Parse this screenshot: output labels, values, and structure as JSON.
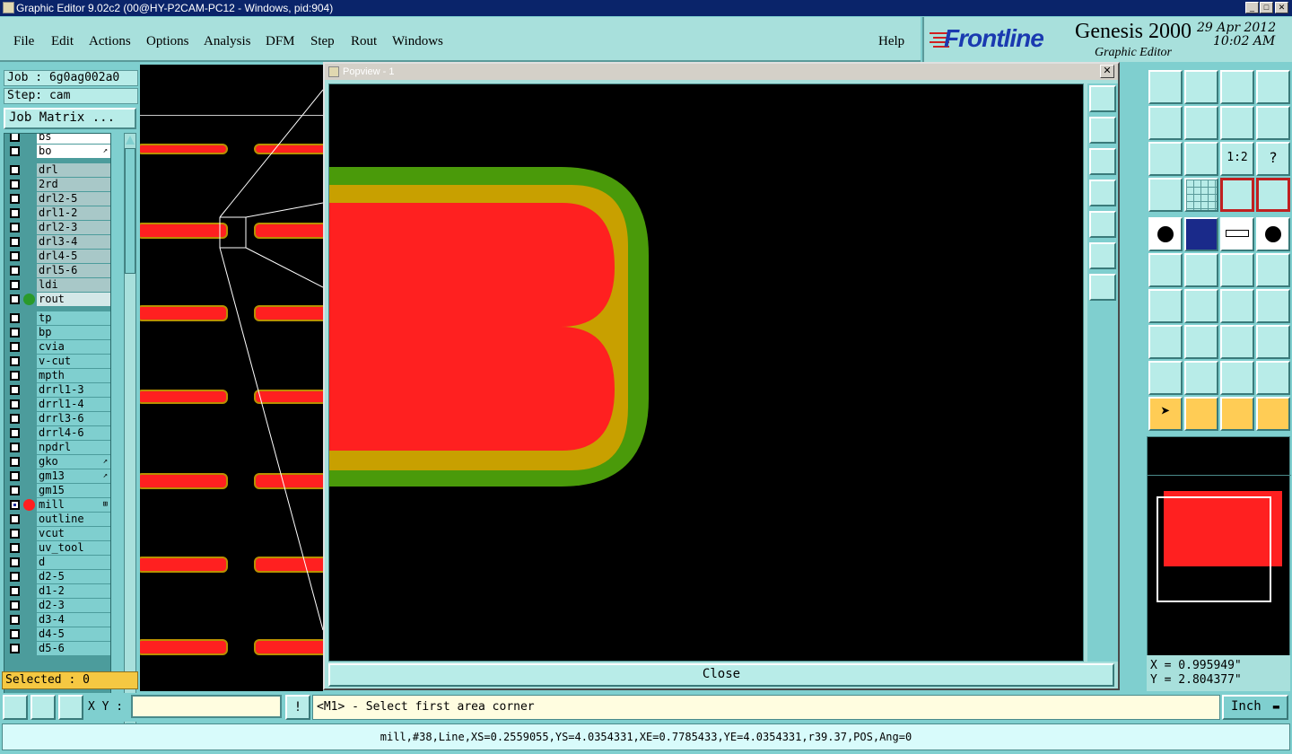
{
  "window": {
    "title": "Graphic Editor 9.02c2 (00@HY-P2CAM-PC12 - Windows, pid:904)",
    "controls": [
      "_",
      "□",
      "✕"
    ]
  },
  "menu": [
    "File",
    "Edit",
    "Actions",
    "Options",
    "Analysis",
    "DFM",
    "Step",
    "Rout",
    "Windows"
  ],
  "help_label": "Help",
  "brand": {
    "logo": "Frontline",
    "product": "Genesis 2000",
    "subtitle": "Graphic Editor",
    "date": "29 Apr 2012",
    "time": "10:02 AM"
  },
  "job": "Job : 6g0ag002a0",
  "step": "Step: cam",
  "job_matrix_label": "Job Matrix ...",
  "layers": [
    {
      "name": "bs",
      "dot": "",
      "selected": false
    },
    {
      "name": "bo",
      "dot": "",
      "selected": false,
      "mark": "↗"
    },
    {
      "name": "drl",
      "dot": "",
      "selected": false
    },
    {
      "name": "2rd",
      "dot": "",
      "selected": false
    },
    {
      "name": "drl2-5",
      "dot": "",
      "selected": false
    },
    {
      "name": "drl1-2",
      "dot": "",
      "selected": false
    },
    {
      "name": "drl2-3",
      "dot": "",
      "selected": false
    },
    {
      "name": "drl3-4",
      "dot": "",
      "selected": false
    },
    {
      "name": "drl4-5",
      "dot": "",
      "selected": false
    },
    {
      "name": "drl5-6",
      "dot": "",
      "selected": false
    },
    {
      "name": "ldi",
      "dot": "",
      "selected": false
    },
    {
      "name": "rout",
      "dot": "#2a9a2a",
      "selected": false
    },
    {
      "name": "tp",
      "dot": "",
      "selected": false
    },
    {
      "name": "bp",
      "dot": "",
      "selected": false
    },
    {
      "name": "cvia",
      "dot": "",
      "selected": false
    },
    {
      "name": "v-cut",
      "dot": "",
      "selected": false
    },
    {
      "name": "mpth",
      "dot": "",
      "selected": false
    },
    {
      "name": "drrl1-3",
      "dot": "",
      "selected": false
    },
    {
      "name": "drrl1-4",
      "dot": "",
      "selected": false
    },
    {
      "name": "drrl3-6",
      "dot": "",
      "selected": false
    },
    {
      "name": "drrl4-6",
      "dot": "",
      "selected": false
    },
    {
      "name": "npdrl",
      "dot": "",
      "selected": false
    },
    {
      "name": "gko",
      "dot": "",
      "selected": false,
      "mark": "↗"
    },
    {
      "name": "gm13",
      "dot": "",
      "selected": false,
      "mark": "↗"
    },
    {
      "name": "gm15",
      "dot": "",
      "selected": false
    },
    {
      "name": "mill",
      "dot": "#ff2020",
      "selected": true,
      "mark": "⊞"
    },
    {
      "name": "outline",
      "dot": "",
      "selected": false
    },
    {
      "name": "vcut",
      "dot": "",
      "selected": false
    },
    {
      "name": "uv_tool",
      "dot": "",
      "selected": false
    },
    {
      "name": "d",
      "dot": "",
      "selected": false
    },
    {
      "name": "d2-5",
      "dot": "",
      "selected": false
    },
    {
      "name": "d1-2",
      "dot": "",
      "selected": false
    },
    {
      "name": "d2-3",
      "dot": "",
      "selected": false
    },
    {
      "name": "d3-4",
      "dot": "",
      "selected": false
    },
    {
      "name": "d4-5",
      "dot": "",
      "selected": false
    },
    {
      "name": "d5-6",
      "dot": "",
      "selected": false
    }
  ],
  "selected_label": "Selected : 0",
  "popview": {
    "title": "Popview - 1",
    "close_label": "Close"
  },
  "coords": {
    "x": "X = 0.995949\"",
    "y": "Y = 2.804377\""
  },
  "bottom": {
    "xy_label": "X Y :",
    "xy_value": "",
    "prompt": "<M1> - Select first area corner",
    "unit": "Inch"
  },
  "status": "mill,#38,Line,XS=0.2559055,YS=4.0354331,XE=0.7785433,YE=4.0354331,r39.37,POS,Ang=0",
  "colors": {
    "feature_red": "#ff2020",
    "feature_gold": "#c8a000",
    "feature_green": "#4a9a0a",
    "panel": "#7fcfcf"
  }
}
